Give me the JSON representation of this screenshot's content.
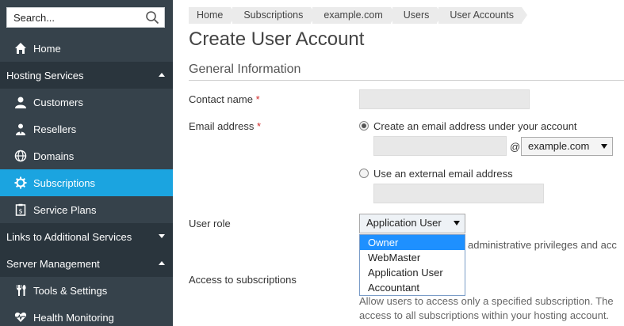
{
  "sidebar": {
    "search_placeholder": "Search...",
    "items": [
      {
        "label": "Home"
      },
      {
        "label": "Hosting Services"
      },
      {
        "label": "Customers"
      },
      {
        "label": "Resellers"
      },
      {
        "label": "Domains"
      },
      {
        "label": "Subscriptions"
      },
      {
        "label": "Service Plans"
      },
      {
        "label": "Links to Additional Services"
      },
      {
        "label": "Server Management"
      },
      {
        "label": "Tools & Settings"
      },
      {
        "label": "Health Monitoring"
      }
    ]
  },
  "breadcrumb": [
    "Home",
    "Subscriptions",
    "example.com",
    "Users",
    "User Accounts"
  ],
  "page_title": "Create User Account",
  "section_title": "General Information",
  "form": {
    "contact_name_label": "Contact name",
    "email_label": "Email address",
    "required_mark": "*",
    "email_option_internal": "Create an email address under your account",
    "at_sign": "@",
    "domain_select_value": "example.com",
    "email_option_external": "Use an external email address",
    "user_role_label": "User role",
    "user_role_value": "Application User",
    "user_role_options": [
      "Owner",
      "WebMaster",
      "Application User",
      "Accountant"
    ],
    "role_hint_partial": "administrative privileges and acc",
    "access_label": "Access to subscriptions",
    "access_hint_line1": "Allow users to access only a specified subscription. The",
    "access_hint_line2": "access to all subscriptions within your hosting account."
  },
  "colors": {
    "sidebar_bg": "#36424b",
    "sidebar_section_bg": "#2a353d",
    "active_bg": "#1ba4e0",
    "dropdown_selected": "#1e90ff"
  }
}
